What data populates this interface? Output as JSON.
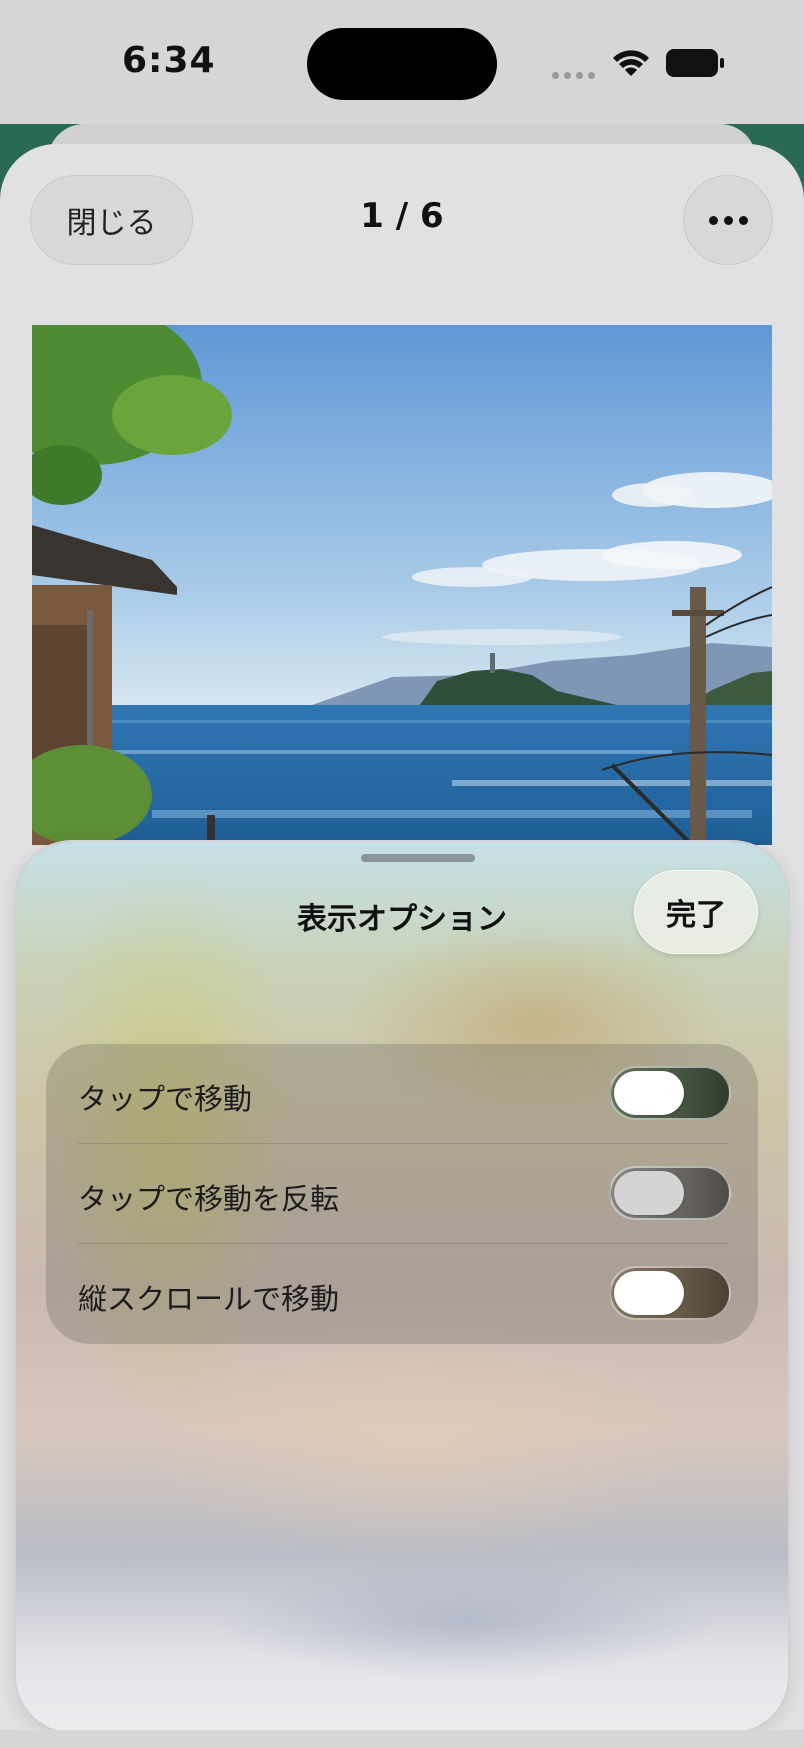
{
  "status_bar": {
    "time": "6:34"
  },
  "header": {
    "close_label": "閉じる",
    "page_counter": "1 / 6",
    "more_icon": "ellipsis-icon"
  },
  "photo": {
    "subject": "coastal-sea-view-photo"
  },
  "sheet": {
    "title": "表示オプション",
    "done_label": "完了",
    "options": [
      {
        "label": "タップで移動",
        "enabled": false
      },
      {
        "label": "タップで移動を反転",
        "enabled": false
      },
      {
        "label": "縦スクロールで移動",
        "enabled": false
      }
    ]
  }
}
